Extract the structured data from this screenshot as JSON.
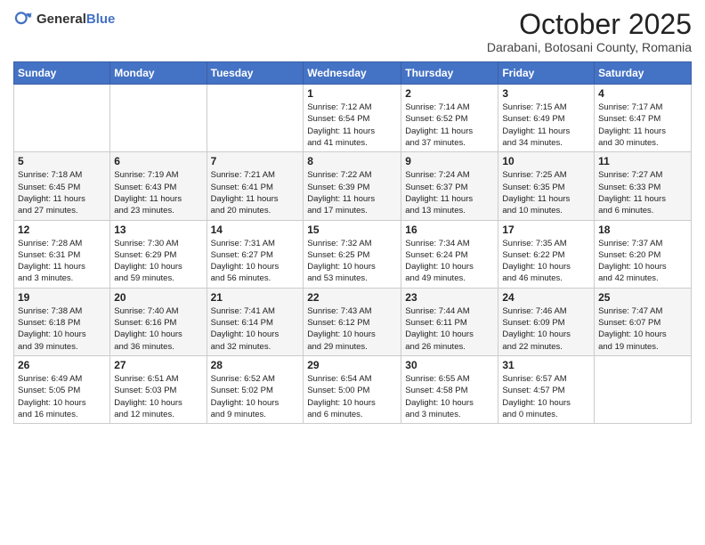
{
  "header": {
    "logo_general": "General",
    "logo_blue": "Blue",
    "title": "October 2025",
    "location": "Darabani, Botosani County, Romania"
  },
  "weekdays": [
    "Sunday",
    "Monday",
    "Tuesday",
    "Wednesday",
    "Thursday",
    "Friday",
    "Saturday"
  ],
  "weeks": [
    [
      {
        "day": "",
        "info": ""
      },
      {
        "day": "",
        "info": ""
      },
      {
        "day": "",
        "info": ""
      },
      {
        "day": "1",
        "info": "Sunrise: 7:12 AM\nSunset: 6:54 PM\nDaylight: 11 hours\nand 41 minutes."
      },
      {
        "day": "2",
        "info": "Sunrise: 7:14 AM\nSunset: 6:52 PM\nDaylight: 11 hours\nand 37 minutes."
      },
      {
        "day": "3",
        "info": "Sunrise: 7:15 AM\nSunset: 6:49 PM\nDaylight: 11 hours\nand 34 minutes."
      },
      {
        "day": "4",
        "info": "Sunrise: 7:17 AM\nSunset: 6:47 PM\nDaylight: 11 hours\nand 30 minutes."
      }
    ],
    [
      {
        "day": "5",
        "info": "Sunrise: 7:18 AM\nSunset: 6:45 PM\nDaylight: 11 hours\nand 27 minutes."
      },
      {
        "day": "6",
        "info": "Sunrise: 7:19 AM\nSunset: 6:43 PM\nDaylight: 11 hours\nand 23 minutes."
      },
      {
        "day": "7",
        "info": "Sunrise: 7:21 AM\nSunset: 6:41 PM\nDaylight: 11 hours\nand 20 minutes."
      },
      {
        "day": "8",
        "info": "Sunrise: 7:22 AM\nSunset: 6:39 PM\nDaylight: 11 hours\nand 17 minutes."
      },
      {
        "day": "9",
        "info": "Sunrise: 7:24 AM\nSunset: 6:37 PM\nDaylight: 11 hours\nand 13 minutes."
      },
      {
        "day": "10",
        "info": "Sunrise: 7:25 AM\nSunset: 6:35 PM\nDaylight: 11 hours\nand 10 minutes."
      },
      {
        "day": "11",
        "info": "Sunrise: 7:27 AM\nSunset: 6:33 PM\nDaylight: 11 hours\nand 6 minutes."
      }
    ],
    [
      {
        "day": "12",
        "info": "Sunrise: 7:28 AM\nSunset: 6:31 PM\nDaylight: 11 hours\nand 3 minutes."
      },
      {
        "day": "13",
        "info": "Sunrise: 7:30 AM\nSunset: 6:29 PM\nDaylight: 10 hours\nand 59 minutes."
      },
      {
        "day": "14",
        "info": "Sunrise: 7:31 AM\nSunset: 6:27 PM\nDaylight: 10 hours\nand 56 minutes."
      },
      {
        "day": "15",
        "info": "Sunrise: 7:32 AM\nSunset: 6:25 PM\nDaylight: 10 hours\nand 53 minutes."
      },
      {
        "day": "16",
        "info": "Sunrise: 7:34 AM\nSunset: 6:24 PM\nDaylight: 10 hours\nand 49 minutes."
      },
      {
        "day": "17",
        "info": "Sunrise: 7:35 AM\nSunset: 6:22 PM\nDaylight: 10 hours\nand 46 minutes."
      },
      {
        "day": "18",
        "info": "Sunrise: 7:37 AM\nSunset: 6:20 PM\nDaylight: 10 hours\nand 42 minutes."
      }
    ],
    [
      {
        "day": "19",
        "info": "Sunrise: 7:38 AM\nSunset: 6:18 PM\nDaylight: 10 hours\nand 39 minutes."
      },
      {
        "day": "20",
        "info": "Sunrise: 7:40 AM\nSunset: 6:16 PM\nDaylight: 10 hours\nand 36 minutes."
      },
      {
        "day": "21",
        "info": "Sunrise: 7:41 AM\nSunset: 6:14 PM\nDaylight: 10 hours\nand 32 minutes."
      },
      {
        "day": "22",
        "info": "Sunrise: 7:43 AM\nSunset: 6:12 PM\nDaylight: 10 hours\nand 29 minutes."
      },
      {
        "day": "23",
        "info": "Sunrise: 7:44 AM\nSunset: 6:11 PM\nDaylight: 10 hours\nand 26 minutes."
      },
      {
        "day": "24",
        "info": "Sunrise: 7:46 AM\nSunset: 6:09 PM\nDaylight: 10 hours\nand 22 minutes."
      },
      {
        "day": "25",
        "info": "Sunrise: 7:47 AM\nSunset: 6:07 PM\nDaylight: 10 hours\nand 19 minutes."
      }
    ],
    [
      {
        "day": "26",
        "info": "Sunrise: 6:49 AM\nSunset: 5:05 PM\nDaylight: 10 hours\nand 16 minutes."
      },
      {
        "day": "27",
        "info": "Sunrise: 6:51 AM\nSunset: 5:03 PM\nDaylight: 10 hours\nand 12 minutes."
      },
      {
        "day": "28",
        "info": "Sunrise: 6:52 AM\nSunset: 5:02 PM\nDaylight: 10 hours\nand 9 minutes."
      },
      {
        "day": "29",
        "info": "Sunrise: 6:54 AM\nSunset: 5:00 PM\nDaylight: 10 hours\nand 6 minutes."
      },
      {
        "day": "30",
        "info": "Sunrise: 6:55 AM\nSunset: 4:58 PM\nDaylight: 10 hours\nand 3 minutes."
      },
      {
        "day": "31",
        "info": "Sunrise: 6:57 AM\nSunset: 4:57 PM\nDaylight: 10 hours\nand 0 minutes."
      },
      {
        "day": "",
        "info": ""
      }
    ]
  ]
}
